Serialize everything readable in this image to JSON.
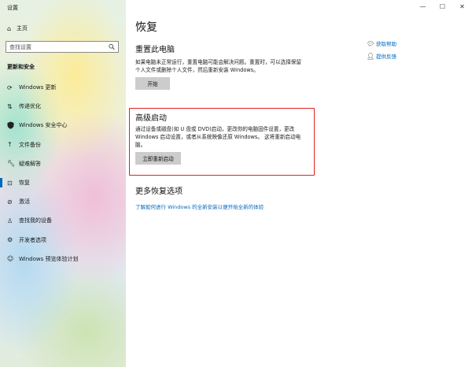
{
  "window": {
    "title": "设置",
    "controls": [
      "—",
      "☐",
      "✕"
    ]
  },
  "sidebar": {
    "home": "主页",
    "search_placeholder": "查找设置",
    "section_title": "更新和安全",
    "items": [
      {
        "label": "Windows 更新",
        "icon": "refresh-icon"
      },
      {
        "label": "传递优化",
        "icon": "delivery-icon"
      },
      {
        "label": "Windows 安全中心",
        "icon": "shield-icon"
      },
      {
        "label": "文件备份",
        "icon": "backup-arrow-icon"
      },
      {
        "label": "疑难解答",
        "icon": "wrench-icon"
      },
      {
        "label": "恢复",
        "icon": "recovery-icon",
        "active": true
      },
      {
        "label": "激活",
        "icon": "check-circle-icon"
      },
      {
        "label": "查找我的设备",
        "icon": "person-pin-icon"
      },
      {
        "label": "开发者选项",
        "icon": "developer-icon"
      },
      {
        "label": "Windows 预览体验计划",
        "icon": "insider-icon"
      }
    ]
  },
  "main": {
    "page_title": "恢复",
    "reset": {
      "heading": "重置此电脑",
      "line1": "如果电脑未正常运行，重置电脑可能会解决问题。重置时，可以选择保留",
      "line2": "个人文件或删除个人文件，然后重新安装 Windows。",
      "button": "开始"
    },
    "advanced": {
      "heading": "高级启动",
      "line1": "通过设备或磁盘(如 U 盘或 DVD)启动，更改你的电脑固件设置，更改",
      "line2": "Windows 启动设置，或者从系统映像还原 Windows。 这将重新启动电",
      "line3": "脑。",
      "button": "立即重新启动"
    },
    "more": {
      "heading": "更多恢复选项",
      "link": "了解如何进行 Windows 的全新安装以便开始全新的体验"
    },
    "help": {
      "get_help": "获取帮助",
      "feedback": "提供反馈"
    }
  }
}
